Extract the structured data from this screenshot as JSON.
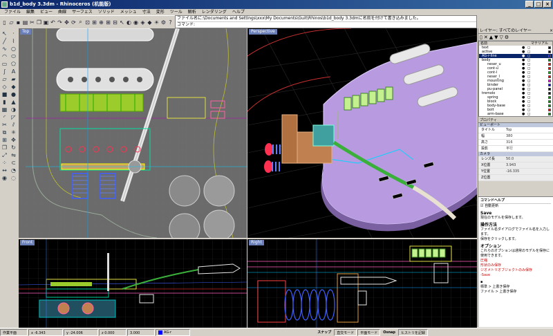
{
  "titlebar": {
    "title": "b1d_body 3.3dm - Rhinoceros (机能版)",
    "minimize": "_",
    "maximize": "□",
    "close": "×"
  },
  "menu": [
    "ファイル",
    "編集",
    "ビュー",
    "曲線",
    "サーフェス",
    "ソリッド",
    "メッシュ",
    "寸法",
    "変形",
    "ツール",
    "解析",
    "レンダリング",
    "ヘルプ"
  ],
  "command": {
    "history": "ファイル名に:\\Documents and Settings\\xxx\\My Documents\\Guit\\Rhinos\\b1d_body 3.3dmに名前を付けて書き込みました。",
    "prompt": "コマンド:"
  },
  "viewports": {
    "top": "Top",
    "perspective": "Perspective",
    "front": "Front",
    "right": "Right"
  },
  "layers": {
    "header": "レイヤー: すべてのレイヤー",
    "columns": {
      "name": "名前",
      "material": "マテリアル"
    },
    "items": [
      {
        "name": "text",
        "color": "#000000"
      },
      {
        "name": "active",
        "color": "#000000"
      },
      {
        "name": "AG-r-line",
        "color": "#0000ff",
        "selected": true
      },
      {
        "name": "body",
        "color": "#00a000"
      },
      {
        "name": "neser_u",
        "color": "#ff0000"
      },
      {
        "name": "cont-u",
        "color": "#ff0000"
      },
      {
        "name": "cont-l",
        "color": "#00c000"
      },
      {
        "name": "neser_l",
        "color": "#ff0000"
      },
      {
        "name": "mounting",
        "color": "#ff00ff"
      },
      {
        "name": "binder",
        "color": "#0000ff"
      },
      {
        "name": "pu-panel",
        "color": "#000000"
      },
      {
        "name": "tremolo",
        "color": "#000000"
      },
      {
        "name": "spring",
        "color": "#00a000"
      },
      {
        "name": "block",
        "color": "#00a000"
      },
      {
        "name": "body-base",
        "color": "#00a000"
      },
      {
        "name": "bolt",
        "color": "#ff0000"
      },
      {
        "name": "arm-base",
        "color": "#00a000"
      }
    ]
  },
  "properties": {
    "header": "プロパティ",
    "section": "ビューポート",
    "rows": [
      {
        "key": "タイトル",
        "value": "Top"
      },
      {
        "key": "幅",
        "value": "380"
      },
      {
        "key": "高さ",
        "value": "316"
      },
      {
        "key": "投影",
        "value": "平行"
      }
    ],
    "camera_section": "カメラ",
    "camera_rows": [
      {
        "key": "レンズ長",
        "value": "50.0"
      },
      {
        "key": "X位置",
        "value": "3.943"
      },
      {
        "key": "Y位置",
        "value": "-16.335"
      },
      {
        "key": "Z位置",
        "value": ""
      }
    ]
  },
  "help": {
    "header": "コマンドヘルプ",
    "autoupdate": "自動更新",
    "title": "Save",
    "desc": "現在のモデルを保存します。",
    "steps_title": "操作方法",
    "step1": "ファイル名ダイアログでファイル名を入力します。",
    "step2": "保存をクリックします。",
    "options_title": "オプション",
    "options_desc": "これらのオプションは通常のモデルを保存に使用できます。",
    "opt1": "圧縮",
    "opt2": "形状のみ保存",
    "opt3": "ジオメトリオブジェクトのみ保存",
    "opt4": "-Save",
    "footer1": "標準 > 上書き保存",
    "footer2": "ファイル > 上書き保存"
  },
  "status": {
    "cplane": "作業平面",
    "x": "x -6.343",
    "y": "y -24.006",
    "z": "z 0.000",
    "value": "3.000",
    "layer_color": "#0000ff",
    "layer": "AG-r",
    "snap": "スナップ",
    "ortho": "直交モード",
    "planar": "平面モード",
    "osnap": "Osnap",
    "history": "ヒストリを記録"
  }
}
